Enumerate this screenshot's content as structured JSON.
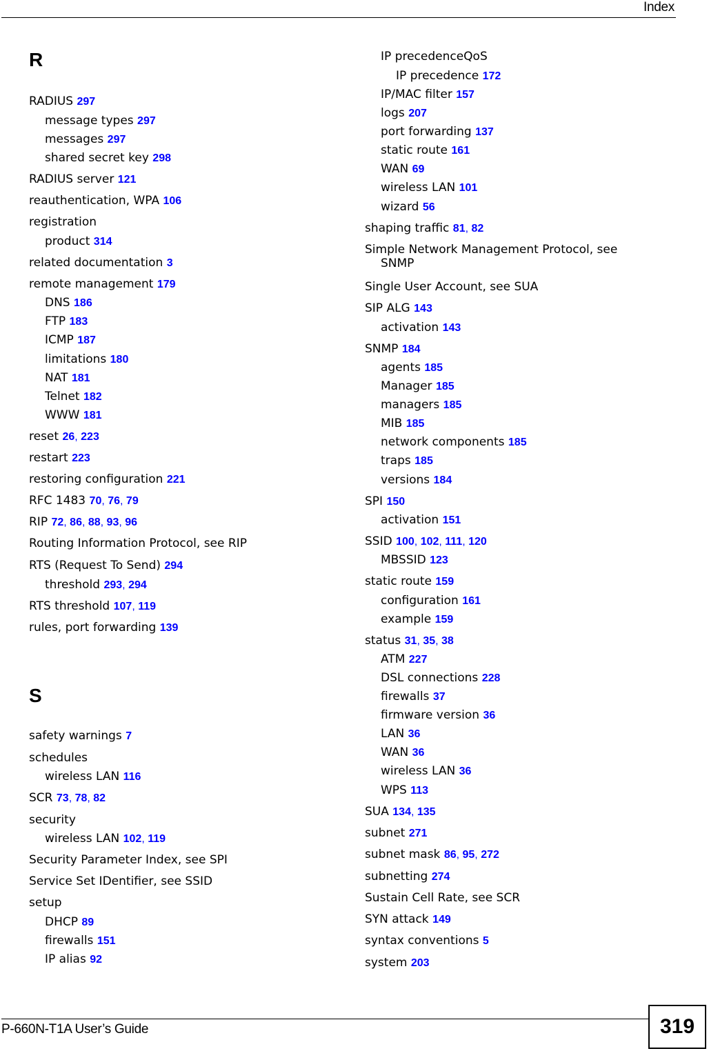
{
  "header": {
    "title": "Index"
  },
  "footer": {
    "guide_title": "P-660N-T1A User’s Guide",
    "page_number": "319"
  },
  "colors": {
    "page_link": "#0000ff",
    "text": "#000000"
  },
  "left_column": {
    "section_r": "R",
    "section_s": "S",
    "entries": [
      {
        "term": "RADIUS",
        "pages": [
          "297"
        ],
        "level": 1
      },
      {
        "term": "message types",
        "pages": [
          "297"
        ],
        "level": 2
      },
      {
        "term": "messages",
        "pages": [
          "297"
        ],
        "level": 2
      },
      {
        "term": "shared secret key",
        "pages": [
          "298"
        ],
        "level": 2
      },
      {
        "term": "RADIUS server",
        "pages": [
          "121"
        ],
        "level": 1
      },
      {
        "term": "reauthentication, WPA",
        "pages": [
          "106"
        ],
        "level": 1
      },
      {
        "term": "registration",
        "pages": [],
        "level": 1
      },
      {
        "term": "product",
        "pages": [
          "314"
        ],
        "level": 2
      },
      {
        "term": "related documentation",
        "pages": [
          "3"
        ],
        "level": 1
      },
      {
        "term": "remote management",
        "pages": [
          "179"
        ],
        "level": 1
      },
      {
        "term": "DNS",
        "pages": [
          "186"
        ],
        "level": 2
      },
      {
        "term": "FTP",
        "pages": [
          "183"
        ],
        "level": 2
      },
      {
        "term": "ICMP",
        "pages": [
          "187"
        ],
        "level": 2
      },
      {
        "term": "limitations",
        "pages": [
          "180"
        ],
        "level": 2
      },
      {
        "term": "NAT",
        "pages": [
          "181"
        ],
        "level": 2
      },
      {
        "term": "Telnet",
        "pages": [
          "182"
        ],
        "level": 2
      },
      {
        "term": "WWW",
        "pages": [
          "181"
        ],
        "level": 2
      },
      {
        "term": "reset",
        "pages": [
          "26",
          "223"
        ],
        "level": 1
      },
      {
        "term": "restart",
        "pages": [
          "223"
        ],
        "level": 1
      },
      {
        "term": "restoring configuration",
        "pages": [
          "221"
        ],
        "level": 1
      },
      {
        "term": "RFC 1483",
        "pages": [
          "70",
          "76",
          "79"
        ],
        "level": 1
      },
      {
        "term": "RIP",
        "pages": [
          "72",
          "86",
          "88",
          "93",
          "96"
        ],
        "level": 1
      },
      {
        "term": "Routing Information Protocol, see RIP",
        "pages": [],
        "level": 1
      },
      {
        "term": "RTS (Request To Send)",
        "pages": [
          "294"
        ],
        "level": 1
      },
      {
        "term": "threshold",
        "pages": [
          "293",
          "294"
        ],
        "level": 2
      },
      {
        "term": "RTS threshold",
        "pages": [
          "107",
          "119"
        ],
        "level": 1
      },
      {
        "term": "rules, port forwarding",
        "pages": [
          "139"
        ],
        "level": 1
      },
      {
        "term": "safety warnings",
        "pages": [
          "7"
        ],
        "level": 1
      },
      {
        "term": "schedules",
        "pages": [],
        "level": 1
      },
      {
        "term": "wireless LAN",
        "pages": [
          "116"
        ],
        "level": 2
      },
      {
        "term": "SCR",
        "pages": [
          "73",
          "78",
          "82"
        ],
        "level": 1
      },
      {
        "term": "security",
        "pages": [],
        "level": 1
      },
      {
        "term": "wireless LAN",
        "pages": [
          "102",
          "119"
        ],
        "level": 2
      },
      {
        "term": "Security Parameter Index, see SPI",
        "pages": [],
        "level": 1
      },
      {
        "term": "Service Set IDentifier, see SSID",
        "pages": [],
        "level": 1
      },
      {
        "term": "setup",
        "pages": [],
        "level": 1
      },
      {
        "term": "DHCP",
        "pages": [
          "89"
        ],
        "level": 2
      },
      {
        "term": "firewalls",
        "pages": [
          "151"
        ],
        "level": 2
      },
      {
        "term": "IP alias",
        "pages": [
          "92"
        ],
        "level": 2
      }
    ]
  },
  "right_column": {
    "entries": [
      {
        "term": "IP precedenceQoS",
        "pages": [],
        "level": 2
      },
      {
        "term": "IP precedence",
        "pages": [
          "172"
        ],
        "level": 3
      },
      {
        "term": "IP/MAC filter",
        "pages": [
          "157"
        ],
        "level": 2
      },
      {
        "term": "logs",
        "pages": [
          "207"
        ],
        "level": 2
      },
      {
        "term": "port forwarding",
        "pages": [
          "137"
        ],
        "level": 2
      },
      {
        "term": "static route",
        "pages": [
          "161"
        ],
        "level": 2
      },
      {
        "term": "WAN",
        "pages": [
          "69"
        ],
        "level": 2
      },
      {
        "term": "wireless LAN",
        "pages": [
          "101"
        ],
        "level": 2
      },
      {
        "term": "wizard",
        "pages": [
          "56"
        ],
        "level": 2
      },
      {
        "term": "shaping traffic",
        "pages": [
          "81",
          "82"
        ],
        "level": 1
      },
      {
        "term": "Simple Network Management Protocol, see",
        "continuation": "SNMP",
        "pages": [],
        "level": 1
      },
      {
        "term": "Single User Account, see SUA",
        "pages": [],
        "level": 1
      },
      {
        "term": "SIP ALG",
        "pages": [
          "143"
        ],
        "level": 1
      },
      {
        "term": "activation",
        "pages": [
          "143"
        ],
        "level": 2
      },
      {
        "term": "SNMP",
        "pages": [
          "184"
        ],
        "level": 1
      },
      {
        "term": "agents",
        "pages": [
          "185"
        ],
        "level": 2
      },
      {
        "term": "Manager",
        "pages": [
          "185"
        ],
        "level": 2
      },
      {
        "term": "managers",
        "pages": [
          "185"
        ],
        "level": 2
      },
      {
        "term": "MIB",
        "pages": [
          "185"
        ],
        "level": 2
      },
      {
        "term": "network components",
        "pages": [
          "185"
        ],
        "level": 2
      },
      {
        "term": "traps",
        "pages": [
          "185"
        ],
        "level": 2
      },
      {
        "term": "versions",
        "pages": [
          "184"
        ],
        "level": 2
      },
      {
        "term": "SPI",
        "pages": [
          "150"
        ],
        "level": 1
      },
      {
        "term": "activation",
        "pages": [
          "151"
        ],
        "level": 2
      },
      {
        "term": "SSID",
        "pages": [
          "100",
          "102",
          "111",
          "120"
        ],
        "level": 1
      },
      {
        "term": "MBSSID",
        "pages": [
          "123"
        ],
        "level": 2
      },
      {
        "term": "static route",
        "pages": [
          "159"
        ],
        "level": 1
      },
      {
        "term": "configuration",
        "pages": [
          "161"
        ],
        "level": 2
      },
      {
        "term": "example",
        "pages": [
          "159"
        ],
        "level": 2
      },
      {
        "term": "status",
        "pages": [
          "31",
          "35",
          "38"
        ],
        "level": 1
      },
      {
        "term": "ATM",
        "pages": [
          "227"
        ],
        "level": 2
      },
      {
        "term": "DSL connections",
        "pages": [
          "228"
        ],
        "level": 2
      },
      {
        "term": "firewalls",
        "pages": [
          "37"
        ],
        "level": 2
      },
      {
        "term": "firmware version",
        "pages": [
          "36"
        ],
        "level": 2
      },
      {
        "term": "LAN",
        "pages": [
          "36"
        ],
        "level": 2
      },
      {
        "term": "WAN",
        "pages": [
          "36"
        ],
        "level": 2
      },
      {
        "term": "wireless LAN",
        "pages": [
          "36"
        ],
        "level": 2
      },
      {
        "term": "WPS",
        "pages": [
          "113"
        ],
        "level": 2
      },
      {
        "term": "SUA",
        "pages": [
          "134",
          "135"
        ],
        "level": 1
      },
      {
        "term": "subnet",
        "pages": [
          "271"
        ],
        "level": 1
      },
      {
        "term": "subnet mask",
        "pages": [
          "86",
          "95",
          "272"
        ],
        "level": 1
      },
      {
        "term": "subnetting",
        "pages": [
          "274"
        ],
        "level": 1
      },
      {
        "term": "Sustain Cell Rate, see SCR",
        "pages": [],
        "level": 1
      },
      {
        "term": "SYN attack",
        "pages": [
          "149"
        ],
        "level": 1
      },
      {
        "term": "syntax conventions",
        "pages": [
          "5"
        ],
        "level": 1
      },
      {
        "term": "system",
        "pages": [
          "203"
        ],
        "level": 1
      }
    ]
  }
}
